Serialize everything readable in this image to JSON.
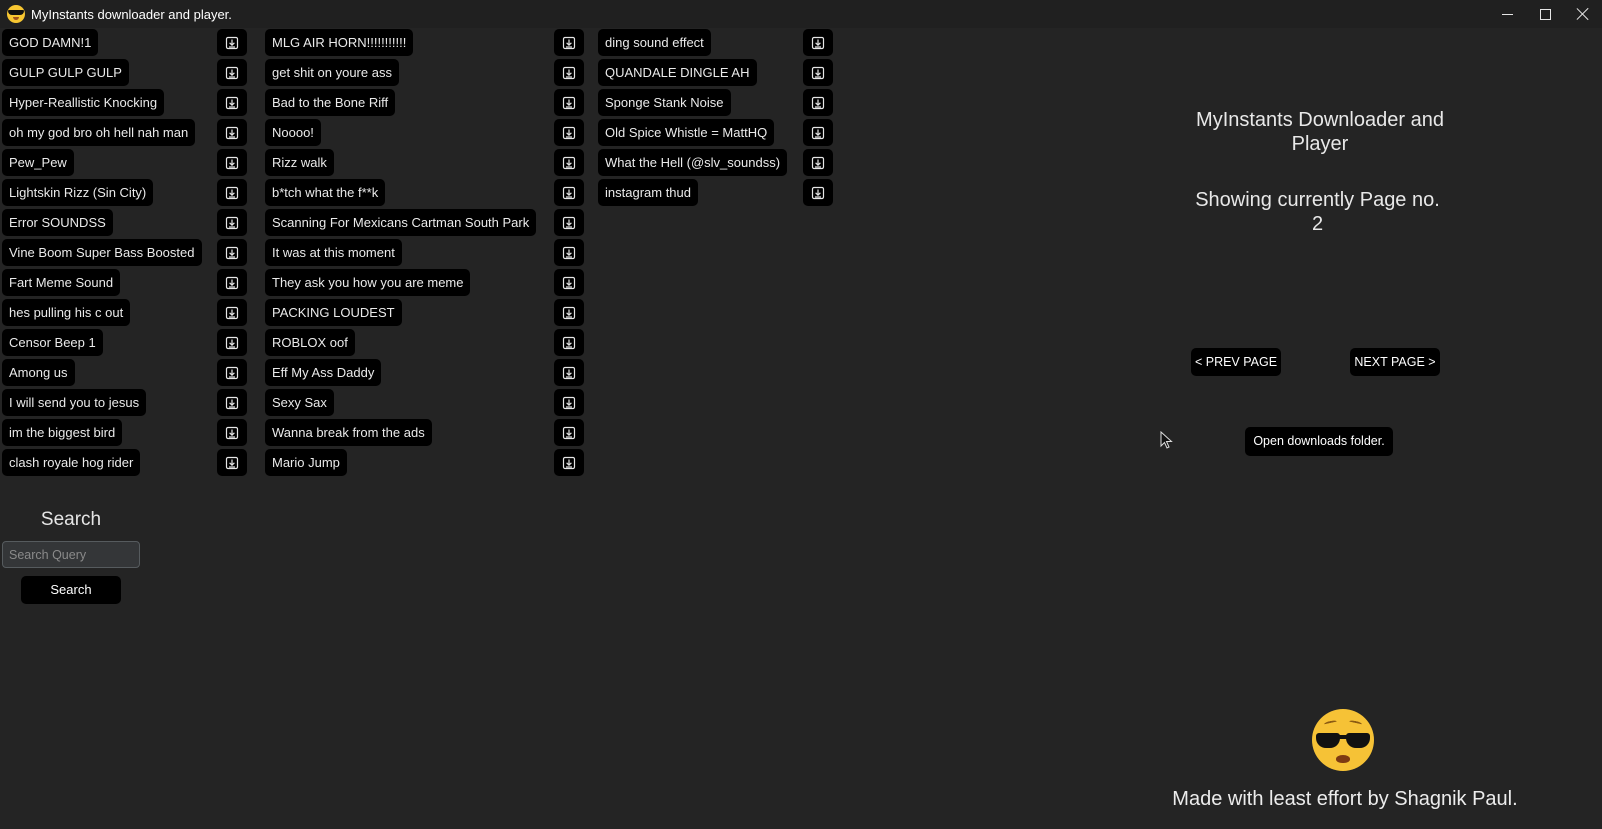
{
  "window": {
    "title": "MyInstants downloader and player.",
    "icon": "sunglasses-emoji-icon",
    "controls": [
      "minimize-icon",
      "maximize-icon",
      "close-icon"
    ]
  },
  "sounds": {
    "column_1": [
      "GOD DAMN!1",
      "GULP GULP GULP",
      "Hyper-Reallistic Knocking",
      "oh my god bro oh hell nah man",
      "Pew_Pew",
      "Lightskin Rizz (Sin City)",
      "Error SOUNDSS",
      "Vine Boom Super Bass Boosted",
      "Fart Meme Sound",
      "hes pulling his c out",
      "Censor Beep 1",
      "Among us",
      "I will send you to jesus",
      "im the biggest bird",
      "clash royale hog rider"
    ],
    "column_2": [
      "MLG AIR HORN!!!!!!!!!!!",
      "get shit on youre ass",
      "Bad to the Bone Riff",
      "Noooo!",
      "Rizz walk",
      "b*tch what the f**k",
      "Scanning For Mexicans Cartman South Park",
      "It was at this moment",
      "They ask you how you are meme",
      "PACKING LOUDEST",
      "ROBLOX oof",
      "Eff My Ass Daddy",
      "Sexy Sax",
      "Wanna break from the ads",
      "Mario Jump"
    ],
    "column_3": [
      "ding sound effect",
      "QUANDALE DINGLE AH",
      "Sponge Stank Noise",
      "Old Spice Whistle = MattHQ",
      "What the Hell (@slv_soundss)",
      "instagram thud"
    ],
    "download_icon": "download-icon"
  },
  "search": {
    "title": "Search",
    "placeholder": "Search Query",
    "value": "",
    "button_label": "Search"
  },
  "panel": {
    "heading": "MyInstants Downloader and Player",
    "page_text": "Showing currently Page no.",
    "page_number": "2",
    "prev_label": "< PREV PAGE",
    "next_label": "NEXT PAGE >",
    "open_folder_label": "Open downloads folder.",
    "credit": "Made with least effort by Shagnik Paul."
  },
  "colors": {
    "background": "#242424",
    "titlebar": "#202020",
    "button": "#000000",
    "text": "#e8e8e8",
    "emoji": "#f6c236"
  }
}
